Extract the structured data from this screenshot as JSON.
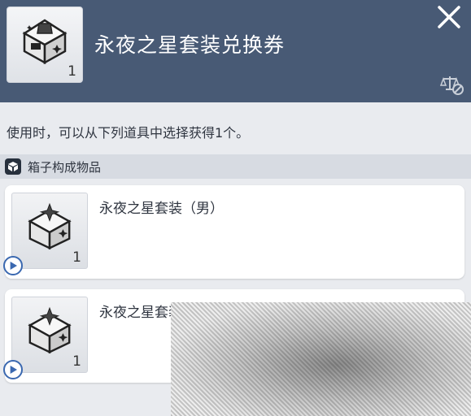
{
  "header": {
    "title": "永夜之星套装兑换券",
    "item_quantity": "1",
    "item_icon": "voucher-box-icon",
    "close_icon": "close-icon",
    "trade_icon": "untradeable-scale-icon"
  },
  "description": "使用时，可以从下列道具中选择获得1个。",
  "section": {
    "label": "箱子构成物品",
    "icon": "box-icon"
  },
  "items": [
    {
      "name": "永夜之星套装（男）",
      "quantity": "1",
      "icon": "gift-box-icon"
    },
    {
      "name": "永夜之星套装（女）",
      "quantity": "1",
      "icon": "gift-box-icon"
    }
  ],
  "colors": {
    "header_bg": "#485a75",
    "page_bg": "#e9ebef",
    "section_bg": "#d7dbe2",
    "play_accent": "#3a68b0"
  }
}
